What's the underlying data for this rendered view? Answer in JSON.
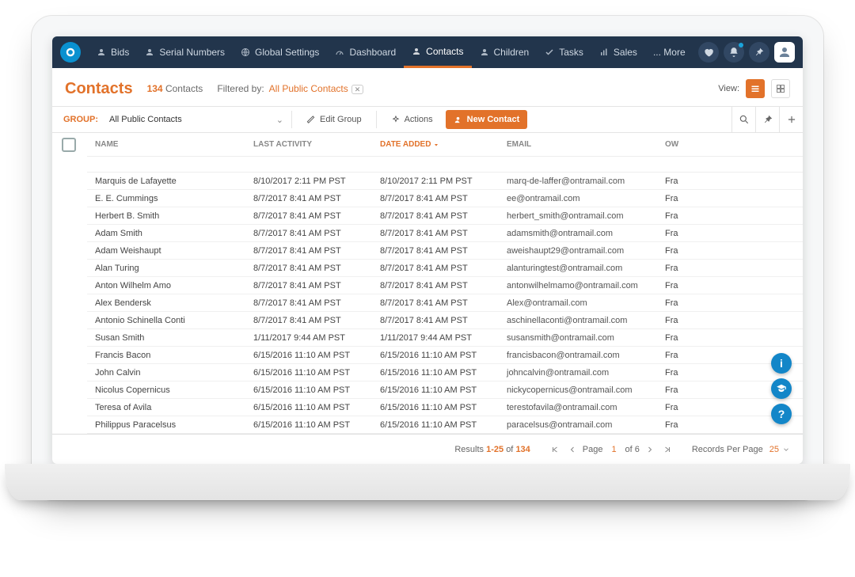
{
  "nav": {
    "items": [
      {
        "icon": "person",
        "label": "Bids"
      },
      {
        "icon": "person",
        "label": "Serial Numbers"
      },
      {
        "icon": "globe",
        "label": "Global Settings"
      },
      {
        "icon": "gauge",
        "label": "Dashboard"
      },
      {
        "icon": "person",
        "label": "Contacts",
        "active": true
      },
      {
        "icon": "person",
        "label": "Children"
      },
      {
        "icon": "check",
        "label": "Tasks"
      },
      {
        "icon": "bars",
        "label": "Sales"
      },
      {
        "icon": "dots",
        "label": "... More"
      }
    ]
  },
  "header": {
    "title": "Contacts",
    "count": 134,
    "count_label": "Contacts",
    "filtered_by_label": "Filtered by:",
    "filter_chip": "All Public Contacts",
    "view_label": "View:"
  },
  "toolbar": {
    "group_label": "GROUP:",
    "group_value": "All Public Contacts",
    "edit_group": "Edit Group",
    "actions": "Actions",
    "new_contact": "New Contact"
  },
  "columns": {
    "name": "NAME",
    "last_activity": "LAST ACTIVITY",
    "date_added": "DATE ADDED",
    "email": "EMAIL",
    "owner": "OW"
  },
  "rows": [
    {
      "name": "Marquis de Lafayette",
      "la": "8/10/2017 2:11 PM PST",
      "da": "8/10/2017 2:11 PM PST",
      "em": "marq-de-laffer@ontramail.com",
      "ow": "Fra"
    },
    {
      "name": "E. E. Cummings",
      "la": "8/7/2017 8:41 AM PST",
      "da": "8/7/2017 8:41 AM PST",
      "em": "ee@ontramail.com",
      "ow": "Fra"
    },
    {
      "name": "Herbert B. Smith",
      "la": "8/7/2017 8:41 AM PST",
      "da": "8/7/2017 8:41 AM PST",
      "em": "herbert_smith@ontramail.com",
      "ow": "Fra"
    },
    {
      "name": "Adam Smith",
      "la": "8/7/2017 8:41 AM PST",
      "da": "8/7/2017 8:41 AM PST",
      "em": "adamsmith@ontramail.com",
      "ow": "Fra"
    },
    {
      "name": "Adam Weishaupt",
      "la": "8/7/2017 8:41 AM PST",
      "da": "8/7/2017 8:41 AM PST",
      "em": "aweishaupt29@ontramail.com",
      "ow": "Fra"
    },
    {
      "name": "Alan Turing",
      "la": "8/7/2017 8:41 AM PST",
      "da": "8/7/2017 8:41 AM PST",
      "em": "alanturingtest@ontramail.com",
      "ow": "Fra"
    },
    {
      "name": "Anton Wilhelm Amo",
      "la": "8/7/2017 8:41 AM PST",
      "da": "8/7/2017 8:41 AM PST",
      "em": "antonwilhelmamo@ontramail.com",
      "ow": "Fra"
    },
    {
      "name": "Alex Bendersk",
      "la": "8/7/2017 8:41 AM PST",
      "da": "8/7/2017 8:41 AM PST",
      "em": "Alex@ontramail.com",
      "ow": "Fra"
    },
    {
      "name": "Antonio Schinella Conti",
      "la": "8/7/2017 8:41 AM PST",
      "da": "8/7/2017 8:41 AM PST",
      "em": "aschinellaconti@ontramail.com",
      "ow": "Fra"
    },
    {
      "name": "Susan Smith",
      "la": "1/11/2017 9:44 AM PST",
      "da": "1/11/2017 9:44 AM PST",
      "em": "susansmith@ontramail.com",
      "ow": "Fra"
    },
    {
      "name": "Francis Bacon",
      "la": "6/15/2016 11:10 AM PST",
      "da": "6/15/2016 11:10 AM PST",
      "em": "francisbacon@ontramail.com",
      "ow": "Fra"
    },
    {
      "name": "John Calvin",
      "la": "6/15/2016 11:10 AM PST",
      "da": "6/15/2016 11:10 AM PST",
      "em": "johncalvin@ontramail.com",
      "ow": "Fra"
    },
    {
      "name": "Nicolus Copernicus",
      "la": "6/15/2016 11:10 AM PST",
      "da": "6/15/2016 11:10 AM PST",
      "em": "nickycopernicus@ontramail.com",
      "ow": "Fra"
    },
    {
      "name": "Teresa of Avila",
      "la": "6/15/2016 11:10 AM PST",
      "da": "6/15/2016 11:10 AM PST",
      "em": "terestofavila@ontramail.com",
      "ow": "Fra"
    },
    {
      "name": "Philippus Paracelsus",
      "la": "6/15/2016 11:10 AM PST",
      "da": "6/15/2016 11:10 AM PST",
      "em": "paracelsus@ontramail.com",
      "ow": "Fra"
    }
  ],
  "pager": {
    "results_label": "Results",
    "range": "1-25",
    "of_label": "of",
    "total": 134,
    "page_label": "Page",
    "page": 1,
    "pages_of": "of 6",
    "rpp_label": "Records Per Page",
    "rpp": 25
  }
}
